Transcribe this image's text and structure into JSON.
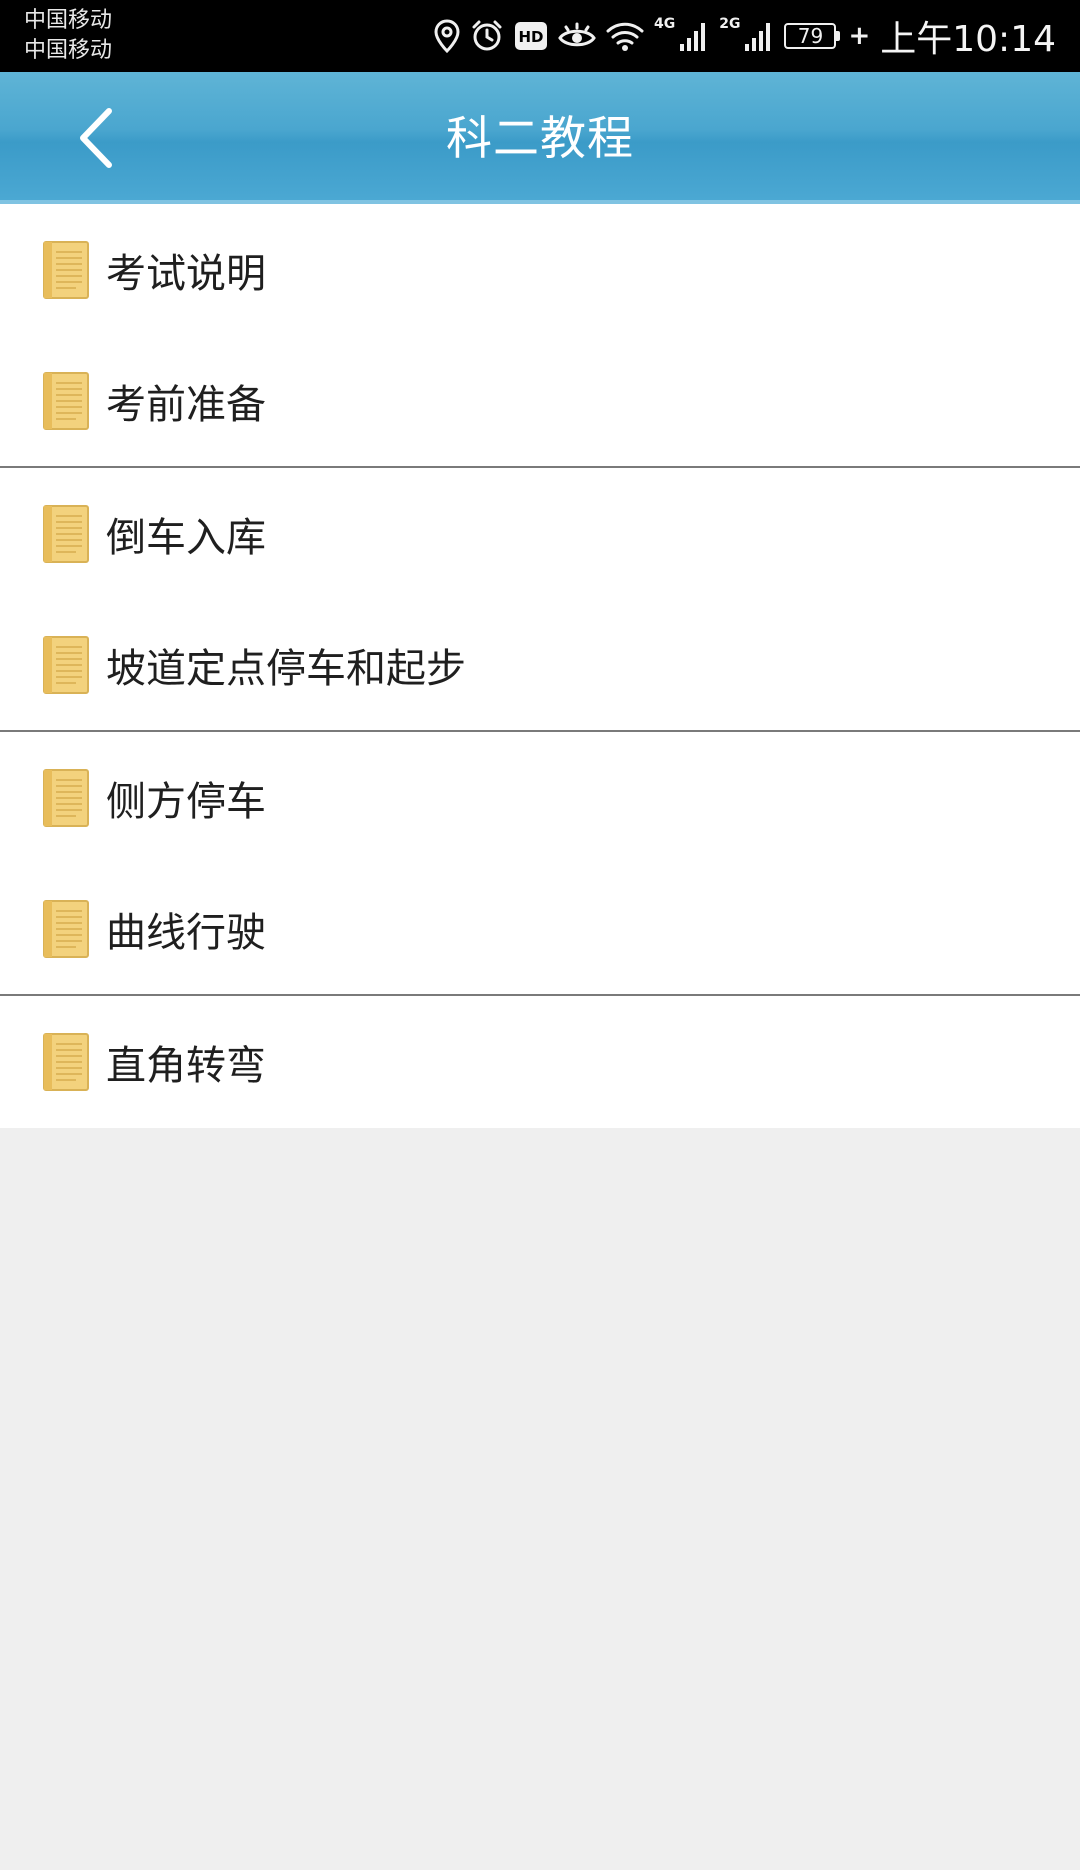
{
  "status_bar": {
    "carrier_1": "中国移动",
    "carrier_2": "中国移动",
    "net_1": "4G",
    "net_2": "2G",
    "battery_level": "79",
    "charging_symbol": "+",
    "time": "上午10:14",
    "icons": [
      "location-icon",
      "alarm-icon",
      "hd-icon",
      "eye-icon",
      "wifi-icon",
      "signal-icon",
      "signal-icon",
      "battery-icon"
    ]
  },
  "header": {
    "title": "科二教程",
    "back_icon": "chevron-left-icon",
    "background_color": "#4aa6cf"
  },
  "list": {
    "icon": "document-icon",
    "items": [
      {
        "label": "考试说明"
      },
      {
        "label": "考前准备"
      },
      {
        "label": "倒车入库"
      },
      {
        "label": "坡道定点停车和起步"
      },
      {
        "label": "侧方停车"
      },
      {
        "label": "曲线行驶"
      },
      {
        "label": "直角转弯"
      }
    ]
  }
}
